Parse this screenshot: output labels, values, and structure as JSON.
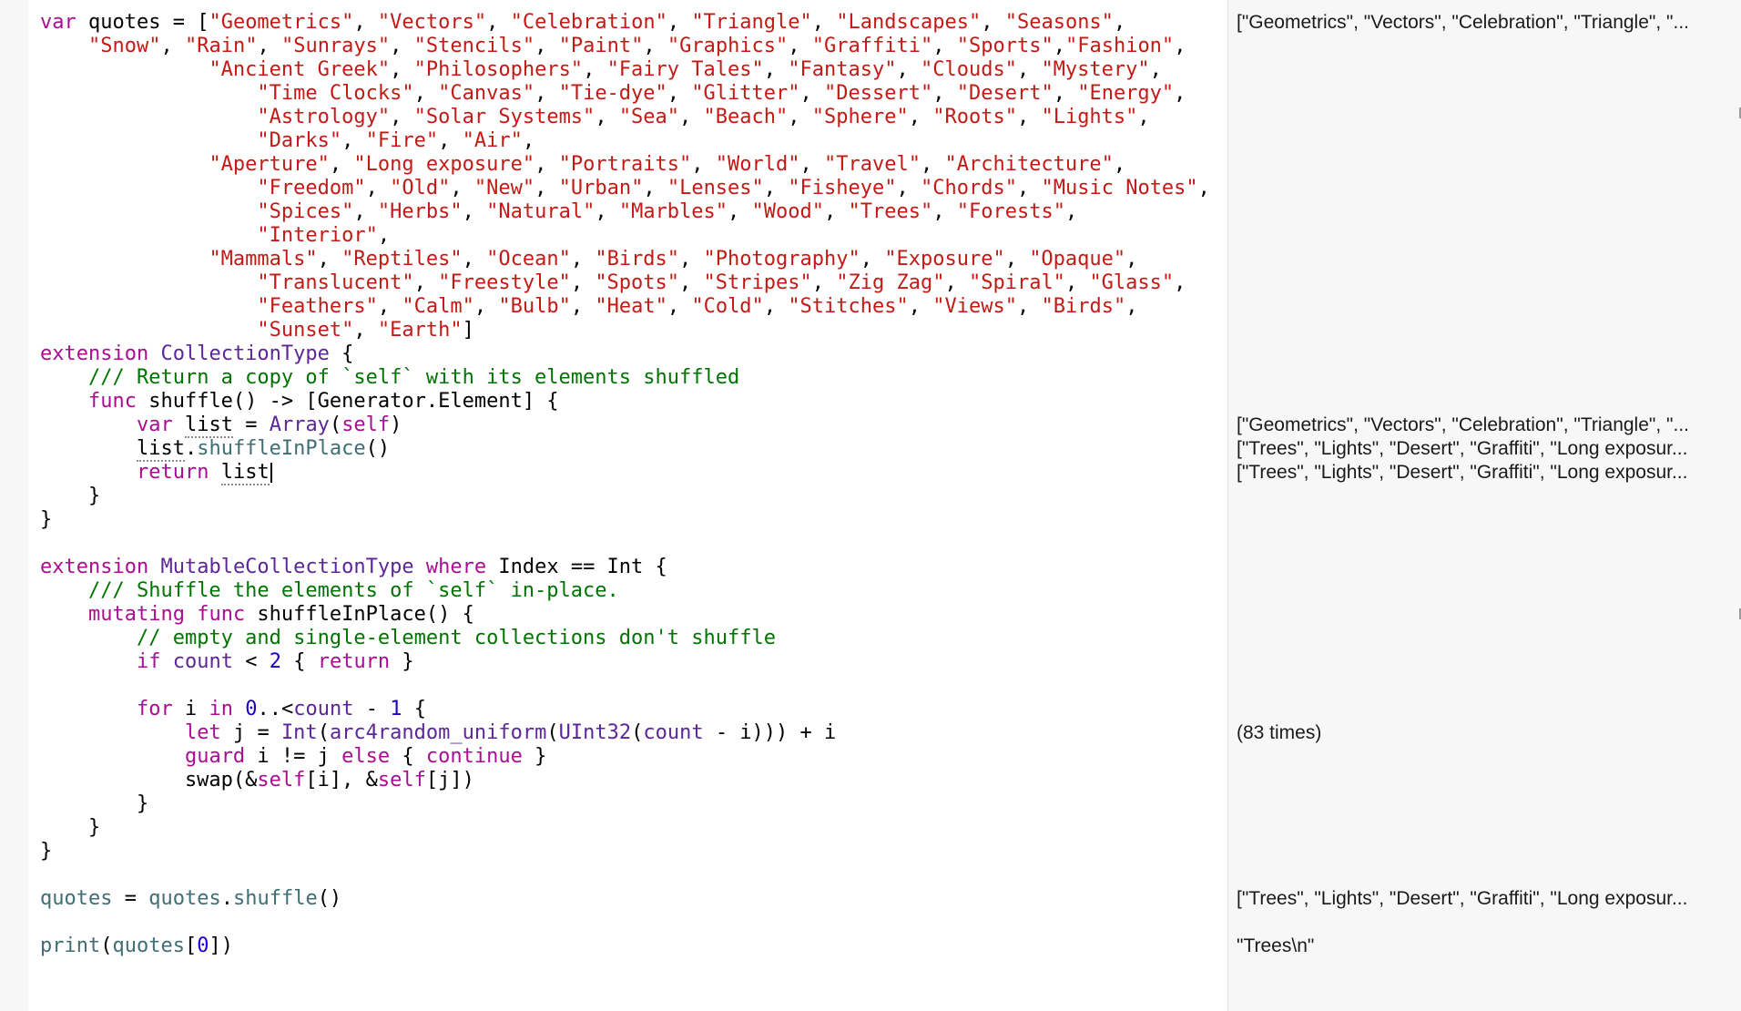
{
  "editor": {
    "lines": [
      [
        [
          "kw",
          "var"
        ],
        [
          "pl",
          " quotes = ["
        ],
        [
          "str",
          "\"Geometrics\""
        ],
        [
          "pl",
          ", "
        ],
        [
          "str",
          "\"Vectors\""
        ],
        [
          "pl",
          ", "
        ],
        [
          "str",
          "\"Celebration\""
        ],
        [
          "pl",
          ", "
        ],
        [
          "str",
          "\"Triangle\""
        ],
        [
          "pl",
          ", "
        ],
        [
          "str",
          "\"Landscapes\""
        ],
        [
          "pl",
          ", "
        ],
        [
          "str",
          "\"Seasons\""
        ],
        [
          "pl",
          ","
        ]
      ],
      [
        [
          "pl",
          "    "
        ],
        [
          "str",
          "\"Snow\""
        ],
        [
          "pl",
          ", "
        ],
        [
          "str",
          "\"Rain\""
        ],
        [
          "pl",
          ", "
        ],
        [
          "str",
          "\"Sunrays\""
        ],
        [
          "pl",
          ", "
        ],
        [
          "str",
          "\"Stencils\""
        ],
        [
          "pl",
          ", "
        ],
        [
          "str",
          "\"Paint\""
        ],
        [
          "pl",
          ", "
        ],
        [
          "str",
          "\"Graphics\""
        ],
        [
          "pl",
          ", "
        ],
        [
          "str",
          "\"Graffiti\""
        ],
        [
          "pl",
          ", "
        ],
        [
          "str",
          "\"Sports\""
        ],
        [
          "pl",
          ","
        ],
        [
          "str",
          "\"Fashion\""
        ],
        [
          "pl",
          ","
        ]
      ],
      [
        [
          "pl",
          "              "
        ],
        [
          "str",
          "\"Ancient Greek\""
        ],
        [
          "pl",
          ", "
        ],
        [
          "str",
          "\"Philosophers\""
        ],
        [
          "pl",
          ", "
        ],
        [
          "str",
          "\"Fairy Tales\""
        ],
        [
          "pl",
          ", "
        ],
        [
          "str",
          "\"Fantasy\""
        ],
        [
          "pl",
          ", "
        ],
        [
          "str",
          "\"Clouds\""
        ],
        [
          "pl",
          ", "
        ],
        [
          "str",
          "\"Mystery\""
        ],
        [
          "pl",
          ","
        ]
      ],
      [
        [
          "pl",
          "                  "
        ],
        [
          "str",
          "\"Time Clocks\""
        ],
        [
          "pl",
          ", "
        ],
        [
          "str",
          "\"Canvas\""
        ],
        [
          "pl",
          ", "
        ],
        [
          "str",
          "\"Tie-dye\""
        ],
        [
          "pl",
          ", "
        ],
        [
          "str",
          "\"Glitter\""
        ],
        [
          "pl",
          ", "
        ],
        [
          "str",
          "\"Dessert\""
        ],
        [
          "pl",
          ", "
        ],
        [
          "str",
          "\"Desert\""
        ],
        [
          "pl",
          ", "
        ],
        [
          "str",
          "\"Energy\""
        ],
        [
          "pl",
          ","
        ]
      ],
      [
        [
          "pl",
          "                  "
        ],
        [
          "str",
          "\"Astrology\""
        ],
        [
          "pl",
          ", "
        ],
        [
          "str",
          "\"Solar Systems\""
        ],
        [
          "pl",
          ", "
        ],
        [
          "str",
          "\"Sea\""
        ],
        [
          "pl",
          ", "
        ],
        [
          "str",
          "\"Beach\""
        ],
        [
          "pl",
          ", "
        ],
        [
          "str",
          "\"Sphere\""
        ],
        [
          "pl",
          ", "
        ],
        [
          "str",
          "\"Roots\""
        ],
        [
          "pl",
          ", "
        ],
        [
          "str",
          "\"Lights\""
        ],
        [
          "pl",
          ","
        ]
      ],
      [
        [
          "pl",
          "                  "
        ],
        [
          "str",
          "\"Darks\""
        ],
        [
          "pl",
          ", "
        ],
        [
          "str",
          "\"Fire\""
        ],
        [
          "pl",
          ", "
        ],
        [
          "str",
          "\"Air\""
        ],
        [
          "pl",
          ","
        ]
      ],
      [
        [
          "pl",
          "              "
        ],
        [
          "str",
          "\"Aperture\""
        ],
        [
          "pl",
          ", "
        ],
        [
          "str",
          "\"Long exposure\""
        ],
        [
          "pl",
          ", "
        ],
        [
          "str",
          "\"Portraits\""
        ],
        [
          "pl",
          ", "
        ],
        [
          "str",
          "\"World\""
        ],
        [
          "pl",
          ", "
        ],
        [
          "str",
          "\"Travel\""
        ],
        [
          "pl",
          ", "
        ],
        [
          "str",
          "\"Architecture\""
        ],
        [
          "pl",
          ","
        ]
      ],
      [
        [
          "pl",
          "                  "
        ],
        [
          "str",
          "\"Freedom\""
        ],
        [
          "pl",
          ", "
        ],
        [
          "str",
          "\"Old\""
        ],
        [
          "pl",
          ", "
        ],
        [
          "str",
          "\"New\""
        ],
        [
          "pl",
          ", "
        ],
        [
          "str",
          "\"Urban\""
        ],
        [
          "pl",
          ", "
        ],
        [
          "str",
          "\"Lenses\""
        ],
        [
          "pl",
          ", "
        ],
        [
          "str",
          "\"Fisheye\""
        ],
        [
          "pl",
          ", "
        ],
        [
          "str",
          "\"Chords\""
        ],
        [
          "pl",
          ", "
        ],
        [
          "str",
          "\"Music Notes\""
        ],
        [
          "pl",
          ","
        ]
      ],
      [
        [
          "pl",
          "                  "
        ],
        [
          "str",
          "\"Spices\""
        ],
        [
          "pl",
          ", "
        ],
        [
          "str",
          "\"Herbs\""
        ],
        [
          "pl",
          ", "
        ],
        [
          "str",
          "\"Natural\""
        ],
        [
          "pl",
          ", "
        ],
        [
          "str",
          "\"Marbles\""
        ],
        [
          "pl",
          ", "
        ],
        [
          "str",
          "\"Wood\""
        ],
        [
          "pl",
          ", "
        ],
        [
          "str",
          "\"Trees\""
        ],
        [
          "pl",
          ", "
        ],
        [
          "str",
          "\"Forests\""
        ],
        [
          "pl",
          ","
        ]
      ],
      [
        [
          "pl",
          "                  "
        ],
        [
          "str",
          "\"Interior\""
        ],
        [
          "pl",
          ","
        ]
      ],
      [
        [
          "pl",
          "              "
        ],
        [
          "str",
          "\"Mammals\""
        ],
        [
          "pl",
          ", "
        ],
        [
          "str",
          "\"Reptiles\""
        ],
        [
          "pl",
          ", "
        ],
        [
          "str",
          "\"Ocean\""
        ],
        [
          "pl",
          ", "
        ],
        [
          "str",
          "\"Birds\""
        ],
        [
          "pl",
          ", "
        ],
        [
          "str",
          "\"Photography\""
        ],
        [
          "pl",
          ", "
        ],
        [
          "str",
          "\"Exposure\""
        ],
        [
          "pl",
          ", "
        ],
        [
          "str",
          "\"Opaque\""
        ],
        [
          "pl",
          ","
        ]
      ],
      [
        [
          "pl",
          "                  "
        ],
        [
          "str",
          "\"Translucent\""
        ],
        [
          "pl",
          ", "
        ],
        [
          "str",
          "\"Freestyle\""
        ],
        [
          "pl",
          ", "
        ],
        [
          "str",
          "\"Spots\""
        ],
        [
          "pl",
          ", "
        ],
        [
          "str",
          "\"Stripes\""
        ],
        [
          "pl",
          ", "
        ],
        [
          "str",
          "\"Zig Zag\""
        ],
        [
          "pl",
          ", "
        ],
        [
          "str",
          "\"Spiral\""
        ],
        [
          "pl",
          ", "
        ],
        [
          "str",
          "\"Glass\""
        ],
        [
          "pl",
          ","
        ]
      ],
      [
        [
          "pl",
          "                  "
        ],
        [
          "str",
          "\"Feathers\""
        ],
        [
          "pl",
          ", "
        ],
        [
          "str",
          "\"Calm\""
        ],
        [
          "pl",
          ", "
        ],
        [
          "str",
          "\"Bulb\""
        ],
        [
          "pl",
          ", "
        ],
        [
          "str",
          "\"Heat\""
        ],
        [
          "pl",
          ", "
        ],
        [
          "str",
          "\"Cold\""
        ],
        [
          "pl",
          ", "
        ],
        [
          "str",
          "\"Stitches\""
        ],
        [
          "pl",
          ", "
        ],
        [
          "str",
          "\"Views\""
        ],
        [
          "pl",
          ", "
        ],
        [
          "str",
          "\"Birds\""
        ],
        [
          "pl",
          ","
        ]
      ],
      [
        [
          "pl",
          "                  "
        ],
        [
          "str",
          "\"Sunset\""
        ],
        [
          "pl",
          ", "
        ],
        [
          "str",
          "\"Earth\""
        ],
        [
          "pl",
          "]"
        ]
      ],
      [
        [
          "kw",
          "extension"
        ],
        [
          "pl",
          " "
        ],
        [
          "type",
          "CollectionType"
        ],
        [
          "pl",
          " {"
        ]
      ],
      [
        [
          "pl",
          "    "
        ],
        [
          "cmt",
          "/// Return a copy of `self` with its elements shuffled"
        ]
      ],
      [
        [
          "pl",
          "    "
        ],
        [
          "kw",
          "func"
        ],
        [
          "pl",
          " shuffle() -> [Generator.Element] {"
        ]
      ],
      [
        [
          "pl",
          "        "
        ],
        [
          "kw",
          "var"
        ],
        [
          "pl",
          " "
        ],
        [
          "ul",
          "list"
        ],
        [
          "pl",
          " = "
        ],
        [
          "type",
          "Array"
        ],
        [
          "pl",
          "("
        ],
        [
          "kw",
          "self"
        ],
        [
          "pl",
          ")"
        ]
      ],
      [
        [
          "pl",
          "        "
        ],
        [
          "ul",
          "list"
        ],
        [
          "pl",
          "."
        ],
        [
          "id",
          "shuffleInPlace"
        ],
        [
          "pl",
          "()"
        ]
      ],
      [
        [
          "pl",
          "        "
        ],
        [
          "kw",
          "return"
        ],
        [
          "pl",
          " "
        ],
        [
          "caretword",
          "list"
        ]
      ],
      [
        [
          "pl",
          "    }"
        ]
      ],
      [
        [
          "pl",
          "}"
        ]
      ],
      [
        [
          "pl",
          ""
        ]
      ],
      [
        [
          "kw",
          "extension"
        ],
        [
          "pl",
          " "
        ],
        [
          "type",
          "MutableCollectionType"
        ],
        [
          "pl",
          " "
        ],
        [
          "kw",
          "where"
        ],
        [
          "pl",
          " Index == Int {"
        ]
      ],
      [
        [
          "pl",
          "    "
        ],
        [
          "cmt",
          "/// Shuffle the elements of `self` in-place."
        ]
      ],
      [
        [
          "pl",
          "    "
        ],
        [
          "kw",
          "mutating"
        ],
        [
          "pl",
          " "
        ],
        [
          "kw",
          "func"
        ],
        [
          "pl",
          " shuffleInPlace() {"
        ]
      ],
      [
        [
          "pl",
          "        "
        ],
        [
          "cmt",
          "// empty and single-element collections don't shuffle"
        ]
      ],
      [
        [
          "pl",
          "        "
        ],
        [
          "kw",
          "if"
        ],
        [
          "pl",
          " "
        ],
        [
          "type",
          "count"
        ],
        [
          "pl",
          " < "
        ],
        [
          "num",
          "2"
        ],
        [
          "pl",
          " { "
        ],
        [
          "kw",
          "return"
        ],
        [
          "pl",
          " }"
        ]
      ],
      [
        [
          "pl",
          ""
        ]
      ],
      [
        [
          "pl",
          "        "
        ],
        [
          "kw",
          "for"
        ],
        [
          "pl",
          " i "
        ],
        [
          "kw",
          "in"
        ],
        [
          "pl",
          " "
        ],
        [
          "num",
          "0"
        ],
        [
          "pl",
          "..<"
        ],
        [
          "type",
          "count"
        ],
        [
          "pl",
          " - "
        ],
        [
          "num",
          "1"
        ],
        [
          "pl",
          " {"
        ]
      ],
      [
        [
          "pl",
          "            "
        ],
        [
          "kw",
          "let"
        ],
        [
          "pl",
          " j = "
        ],
        [
          "type",
          "Int"
        ],
        [
          "pl",
          "("
        ],
        [
          "type",
          "arc4random_uniform"
        ],
        [
          "pl",
          "("
        ],
        [
          "type",
          "UInt32"
        ],
        [
          "pl",
          "("
        ],
        [
          "type",
          "count"
        ],
        [
          "pl",
          " - i))) + i"
        ]
      ],
      [
        [
          "pl",
          "            "
        ],
        [
          "kw",
          "guard"
        ],
        [
          "pl",
          " i != j "
        ],
        [
          "kw",
          "else"
        ],
        [
          "pl",
          " { "
        ],
        [
          "kw",
          "continue"
        ],
        [
          "pl",
          " }"
        ]
      ],
      [
        [
          "pl",
          "            swap(&"
        ],
        [
          "kw",
          "self"
        ],
        [
          "pl",
          "[i], &"
        ],
        [
          "kw",
          "self"
        ],
        [
          "pl",
          "[j])"
        ]
      ],
      [
        [
          "pl",
          "        }"
        ]
      ],
      [
        [
          "pl",
          "    }"
        ]
      ],
      [
        [
          "pl",
          "}"
        ]
      ],
      [
        [
          "pl",
          ""
        ]
      ],
      [
        [
          "id",
          "quotes"
        ],
        [
          "pl",
          " = "
        ],
        [
          "id",
          "quotes"
        ],
        [
          "pl",
          "."
        ],
        [
          "id",
          "shuffle"
        ],
        [
          "pl",
          "()"
        ]
      ],
      [
        [
          "pl",
          ""
        ]
      ],
      [
        [
          "id",
          "print"
        ],
        [
          "pl",
          "("
        ],
        [
          "id",
          "quotes"
        ],
        [
          "pl",
          "["
        ],
        [
          "num",
          "0"
        ],
        [
          "pl",
          "])"
        ]
      ]
    ]
  },
  "results": [
    {
      "line": 0,
      "text": "[\"Geometrics\", \"Vectors\", \"Celebration\", \"Triangle\", \"..."
    },
    {
      "line": 17,
      "text": "[\"Geometrics\", \"Vectors\", \"Celebration\", \"Triangle\", \"..."
    },
    {
      "line": 18,
      "text": "[\"Trees\", \"Lights\", \"Desert\", \"Graffiti\", \"Long exposur..."
    },
    {
      "line": 19,
      "text": "[\"Trees\", \"Lights\", \"Desert\", \"Graffiti\", \"Long exposur..."
    },
    {
      "line": 30,
      "text": "(83 times)"
    },
    {
      "line": 37,
      "text": "[\"Trees\", \"Lights\", \"Desert\", \"Graffiti\", \"Long exposur..."
    },
    {
      "line": 39,
      "text": "\"Trees\\n\""
    }
  ],
  "colors": {
    "keyword": "#aa0d91",
    "string": "#c41a16",
    "comment": "#007400",
    "number": "#1c00cf",
    "type": "#5c2699",
    "identifier": "#3f6e74"
  }
}
